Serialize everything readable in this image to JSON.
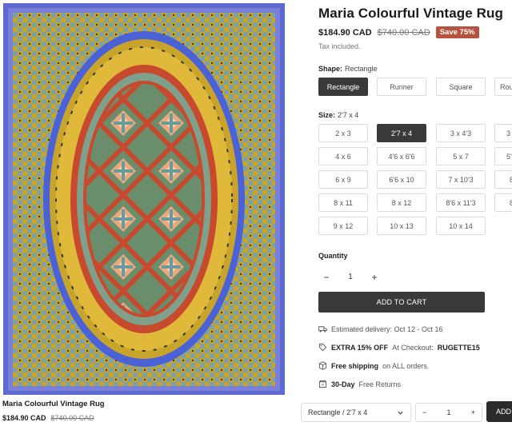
{
  "product": {
    "title": "Maria Colourful Vintage Rug",
    "price": "$184.90 CAD",
    "compare_price": "$740.00 CAD",
    "save_badge": "Save 75%",
    "tax_note": "Tax included."
  },
  "shape": {
    "label": "Shape:",
    "selected": "Rectangle",
    "options": [
      "Rectangle",
      "Runner",
      "Square",
      "Rou"
    ]
  },
  "size": {
    "label": "Size:",
    "selected": "2'7 x 4",
    "options": [
      [
        "2 x 3",
        "2'7 x 4",
        "3 x 4'3",
        "3"
      ],
      [
        "4 x 6",
        "4'6 x 6'6",
        "5 x 7",
        "5'"
      ],
      [
        "6 x 9",
        "6'6 x 10",
        "7 x 10'3",
        "8"
      ],
      [
        "8 x 11",
        "8 x 12",
        "8'6 x 11'3",
        "8"
      ],
      [
        "9 x 12",
        "10 x 13",
        "10 x 14"
      ]
    ]
  },
  "quantity": {
    "label": "Quantity",
    "value": "1",
    "minus": "−",
    "plus": "+"
  },
  "cart": {
    "add_label": "ADD TO CART"
  },
  "info": {
    "delivery": "Estimated delivery: Oct 12 - Oct 16",
    "discount_bold": "EXTRA 15% OFF",
    "discount_mid": "At Checkout:",
    "discount_code": "RUGETTE15",
    "shipping_bold": "Free shipping",
    "shipping_rest": "on ALL orders.",
    "returns_bold": "30-Day",
    "returns_rest": "Free Returns"
  },
  "sticky": {
    "title": "Maria Colourful Vintage Rug",
    "price": "$184.90 CAD",
    "compare_price": "$740.00 CAD",
    "variant": "Rectangle / 2'7 x 4",
    "qty": "1",
    "minus": "−",
    "plus": "+",
    "add_label": "ADD"
  },
  "colors": {
    "accent_badge": "#b5533e",
    "button_dark": "#3a3a3a",
    "rug_border": "#5e6ad1",
    "rug_field": "#c9a42c",
    "rug_medallion_red": "#c84a2e",
    "rug_medallion_green": "#6a8e6c"
  },
  "icons": [
    "truck-icon",
    "tag-icon",
    "box-icon",
    "return-box-icon",
    "chevron-down-icon"
  ]
}
